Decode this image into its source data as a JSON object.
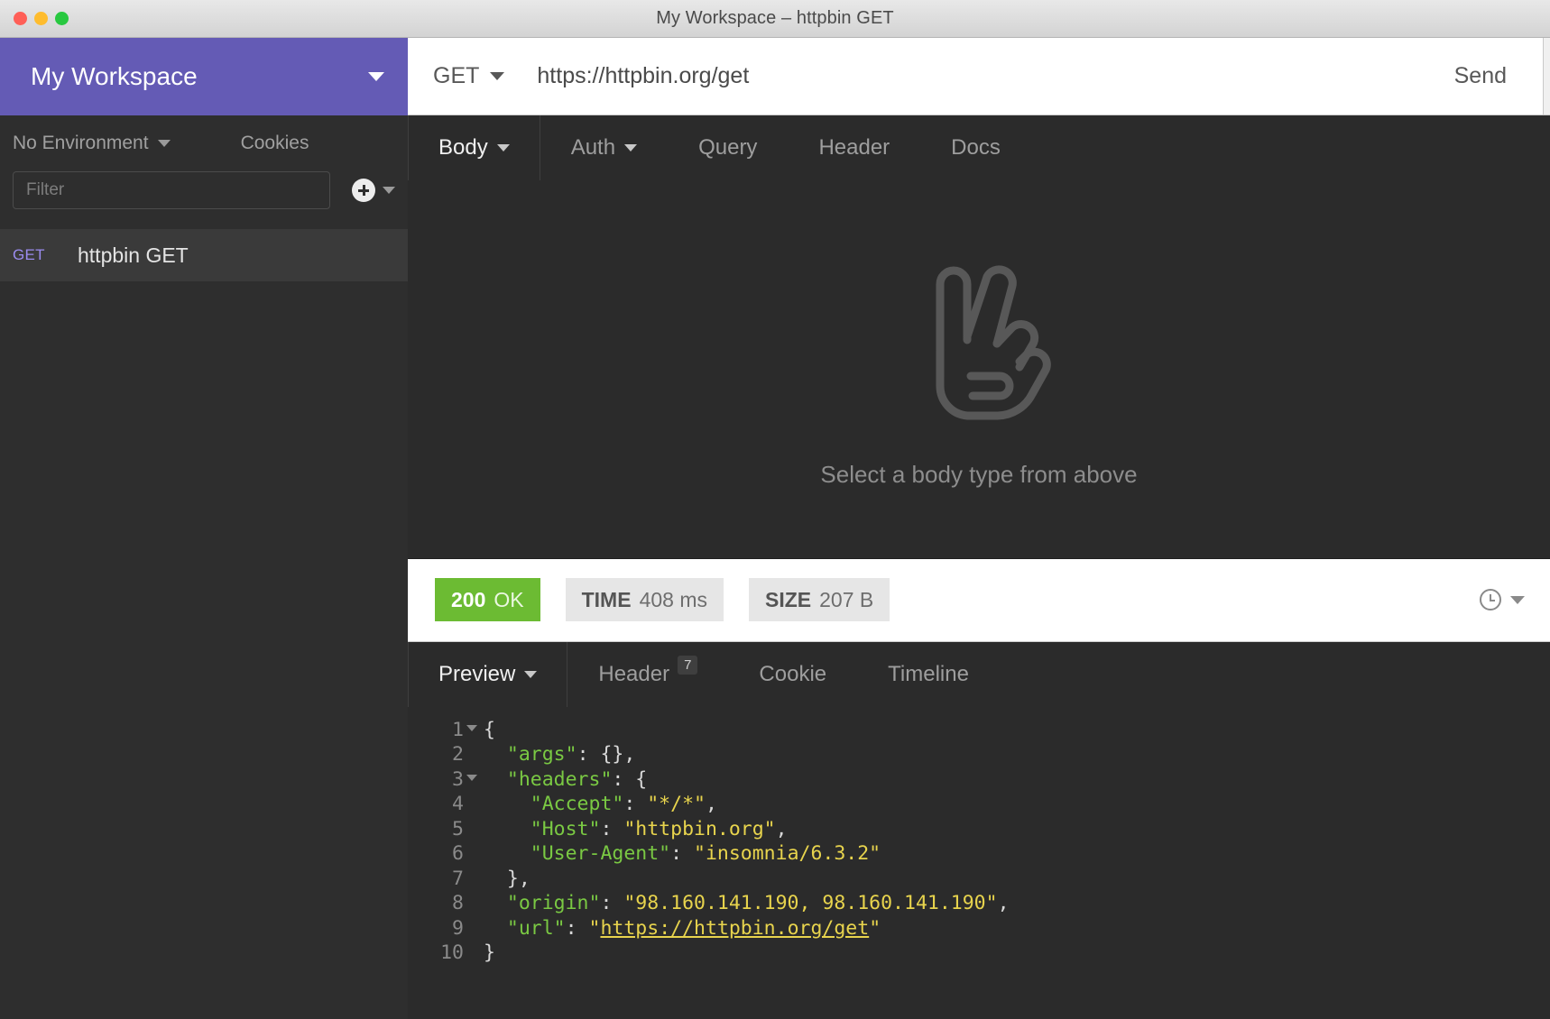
{
  "window": {
    "title": "My Workspace – httpbin GET",
    "traffic_lights": [
      "close",
      "minimize",
      "zoom"
    ]
  },
  "sidebar": {
    "workspace_name": "My Workspace",
    "environment_label": "No Environment",
    "cookies_label": "Cookies",
    "filter_placeholder": "Filter",
    "filter_value": "",
    "add_icon": "plus-circle-icon",
    "requests": [
      {
        "method": "GET",
        "name": "httpbin GET",
        "active": true
      }
    ]
  },
  "request": {
    "method": "GET",
    "url": "https://httpbin.org/get",
    "send_label": "Send",
    "tabs": [
      {
        "label": "Body",
        "active": true,
        "has_caret": true
      },
      {
        "label": "Auth",
        "active": false,
        "has_caret": true
      },
      {
        "label": "Query",
        "active": false,
        "has_caret": false
      },
      {
        "label": "Header",
        "active": false,
        "has_caret": false
      },
      {
        "label": "Docs",
        "active": false,
        "has_caret": false
      }
    ],
    "empty_body_message": "Select a body type from above",
    "empty_body_icon": "hand-peace-icon"
  },
  "response": {
    "status_code": "200",
    "status_text": "OK",
    "time_label": "TIME",
    "time_value": "408 ms",
    "size_label": "SIZE",
    "size_value": "207 B",
    "history_icon": "clock-icon",
    "tabs": [
      {
        "label": "Preview",
        "active": true,
        "has_caret": true,
        "badge": ""
      },
      {
        "label": "Header",
        "active": false,
        "has_caret": false,
        "badge": "7"
      },
      {
        "label": "Cookie",
        "active": false,
        "has_caret": false,
        "badge": ""
      },
      {
        "label": "Timeline",
        "active": false,
        "has_caret": false,
        "badge": ""
      }
    ],
    "body_lines": [
      {
        "n": "1",
        "fold": true,
        "tokens": [
          {
            "t": "{",
            "c": "p"
          }
        ]
      },
      {
        "n": "2",
        "fold": false,
        "tokens": [
          {
            "t": "  ",
            "c": "p"
          },
          {
            "t": "\"args\"",
            "c": "k"
          },
          {
            "t": ": {},",
            "c": "p"
          }
        ]
      },
      {
        "n": "3",
        "fold": true,
        "tokens": [
          {
            "t": "  ",
            "c": "p"
          },
          {
            "t": "\"headers\"",
            "c": "k"
          },
          {
            "t": ": {",
            "c": "p"
          }
        ]
      },
      {
        "n": "4",
        "fold": false,
        "tokens": [
          {
            "t": "    ",
            "c": "p"
          },
          {
            "t": "\"Accept\"",
            "c": "k"
          },
          {
            "t": ": ",
            "c": "p"
          },
          {
            "t": "\"*/*\"",
            "c": "s"
          },
          {
            "t": ",",
            "c": "p"
          }
        ]
      },
      {
        "n": "5",
        "fold": false,
        "tokens": [
          {
            "t": "    ",
            "c": "p"
          },
          {
            "t": "\"Host\"",
            "c": "k"
          },
          {
            "t": ": ",
            "c": "p"
          },
          {
            "t": "\"httpbin.org\"",
            "c": "s"
          },
          {
            "t": ",",
            "c": "p"
          }
        ]
      },
      {
        "n": "6",
        "fold": false,
        "tokens": [
          {
            "t": "    ",
            "c": "p"
          },
          {
            "t": "\"User-Agent\"",
            "c": "k"
          },
          {
            "t": ": ",
            "c": "p"
          },
          {
            "t": "\"insomnia/6.3.2\"",
            "c": "s"
          }
        ]
      },
      {
        "n": "7",
        "fold": false,
        "tokens": [
          {
            "t": "  },",
            "c": "p"
          }
        ]
      },
      {
        "n": "8",
        "fold": false,
        "tokens": [
          {
            "t": "  ",
            "c": "p"
          },
          {
            "t": "\"origin\"",
            "c": "k"
          },
          {
            "t": ": ",
            "c": "p"
          },
          {
            "t": "\"98.160.141.190, 98.160.141.190\"",
            "c": "s"
          },
          {
            "t": ",",
            "c": "p"
          }
        ]
      },
      {
        "n": "9",
        "fold": false,
        "tokens": [
          {
            "t": "  ",
            "c": "p"
          },
          {
            "t": "\"url\"",
            "c": "k"
          },
          {
            "t": ": ",
            "c": "p"
          },
          {
            "t": "\"",
            "c": "s"
          },
          {
            "t": "https://httpbin.org/get",
            "c": "lnk"
          },
          {
            "t": "\"",
            "c": "s"
          }
        ]
      },
      {
        "n": "10",
        "fold": false,
        "tokens": [
          {
            "t": "}",
            "c": "p"
          }
        ]
      }
    ]
  },
  "colors": {
    "accent_purple": "#645bb5",
    "status_green": "#6cbb33",
    "method_get": "#9b8cf0",
    "json_key": "#7ac943",
    "json_string": "#e8d44d",
    "sidebar_bg": "#2e2e2e",
    "pane_bg": "#2b2b2b"
  }
}
